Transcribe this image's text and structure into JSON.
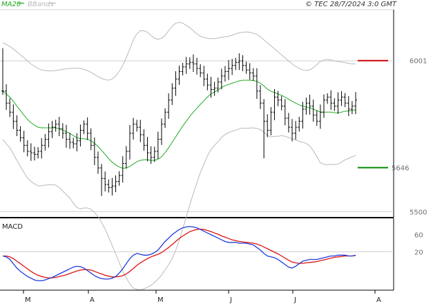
{
  "header": {
    "ma_label": "MA20",
    "bb_label": "BBands",
    "copyright": "© TEC 28/7/2024 3:0 GMT"
  },
  "colors": {
    "ma": "#22aa22",
    "bands": "#b9b9b9",
    "price": "#000000",
    "resistance": "#cc0000",
    "support": "#008800",
    "macd": "#1e3adc",
    "signal": "#dd1111",
    "grid": "#cfcfcf",
    "axis": "#000000"
  },
  "chart_data": [
    {
      "type": "ohlc",
      "name": "price",
      "price_labels": [
        "6001",
        "5646",
        "5500"
      ],
      "ylim": [
        5480,
        6170
      ],
      "grid": [
        6000,
        5500
      ],
      "levels": [
        {
          "label": "6001",
          "value": 6001,
          "color": "#cc0000"
        },
        {
          "label": "5646",
          "value": 5646,
          "color": "#008800"
        }
      ],
      "x_ticks": [
        "M",
        "A",
        "M",
        "J",
        "J",
        "A"
      ],
      "closes": [
        5900,
        5860,
        5830,
        5800,
        5770,
        5745,
        5720,
        5700,
        5695,
        5690,
        5700,
        5720,
        5740,
        5765,
        5780,
        5790,
        5775,
        5760,
        5740,
        5730,
        5725,
        5735,
        5770,
        5790,
        5760,
        5720,
        5680,
        5645,
        5610,
        5590,
        5580,
        5585,
        5600,
        5620,
        5660,
        5700,
        5760,
        5790,
        5780,
        5755,
        5720,
        5695,
        5680,
        5700,
        5740,
        5790,
        5830,
        5870,
        5910,
        5940,
        5965,
        5980,
        5990,
        5995,
        5990,
        5975,
        5960,
        5940,
        5920,
        5905,
        5910,
        5930,
        5950,
        5965,
        5975,
        5985,
        5995,
        6000,
        5985,
        5970,
        5960,
        5950,
        5900,
        5860,
        5800,
        5770,
        5830,
        5880,
        5870,
        5850,
        5810,
        5780,
        5760,
        5780,
        5800,
        5840,
        5860,
        5850,
        5820,
        5800,
        5830,
        5870,
        5880,
        5860,
        5850,
        5870,
        5880,
        5860,
        5840,
        5850,
        5870
      ],
      "ma20": [
        5900,
        5890,
        5880,
        5866,
        5850,
        5835,
        5820,
        5806,
        5795,
        5787,
        5780,
        5778,
        5778,
        5778,
        5778,
        5778,
        5775,
        5770,
        5765,
        5760,
        5752,
        5745,
        5742,
        5742,
        5740,
        5735,
        5726,
        5716,
        5703,
        5690,
        5676,
        5664,
        5655,
        5648,
        5644,
        5645,
        5650,
        5658,
        5666,
        5670,
        5672,
        5672,
        5670,
        5670,
        5674,
        5682,
        5696,
        5712,
        5730,
        5748,
        5766,
        5784,
        5800,
        5816,
        5830,
        5843,
        5856,
        5868,
        5880,
        5890,
        5897,
        5904,
        5912,
        5918,
        5922,
        5926,
        5930,
        5934,
        5936,
        5936,
        5936,
        5935,
        5932,
        5926,
        5917,
        5906,
        5899,
        5895,
        5890,
        5886,
        5880,
        5873,
        5866,
        5860,
        5854,
        5850,
        5847,
        5844,
        5840,
        5835,
        5830,
        5830,
        5830,
        5830,
        5828,
        5828,
        5830,
        5833,
        5834,
        5836,
        5838
      ],
      "bb_upper": [
        6060,
        6055,
        6048,
        6040,
        6030,
        6020,
        6010,
        6000,
        5990,
        5982,
        5975,
        5970,
        5968,
        5967,
        5967,
        5968,
        5970,
        5972,
        5974,
        5975,
        5976,
        5976,
        5975,
        5972,
        5968,
        5962,
        5955,
        5948,
        5942,
        5938,
        5936,
        5940,
        5950,
        5965,
        5985,
        6010,
        6040,
        6070,
        6090,
        6100,
        6100,
        6095,
        6085,
        6075,
        6072,
        6075,
        6085,
        6100,
        6115,
        6125,
        6128,
        6125,
        6118,
        6110,
        6100,
        6090,
        6082,
        6078,
        6075,
        6074,
        6074,
        6076,
        6078,
        6080,
        6082,
        6085,
        6090,
        6093,
        6095,
        6096,
        6095,
        6092,
        6088,
        6080,
        6070,
        6060,
        6050,
        6040,
        6030,
        6020,
        6010,
        6000,
        5990,
        5982,
        5975,
        5970,
        5968,
        5970,
        5978,
        5988,
        5998,
        6003,
        6005,
        6003,
        6000,
        5998,
        5996,
        5994,
        5992,
        5990,
        5990
      ],
      "bb_lower": [
        5740,
        5725,
        5712,
        5692,
        5670,
        5650,
        5630,
        5612,
        5600,
        5592,
        5585,
        5586,
        5588,
        5589,
        5589,
        5588,
        5580,
        5568,
        5556,
        5545,
        5528,
        5514,
        5509,
        5512,
        5512,
        5508,
        5497,
        5484,
        5464,
        5442,
        5416,
        5388,
        5360,
        5331,
        5303,
        5280,
        5260,
        5246,
        5242,
        5240,
        5244,
        5249,
        5255,
        5265,
        5276,
        5289,
        5307,
        5324,
        5345,
        5371,
        5404,
        5443,
        5482,
        5522,
        5560,
        5596,
        5630,
        5658,
        5685,
        5706,
        5720,
        5732,
        5746,
        5756,
        5762,
        5767,
        5770,
        5775,
        5777,
        5776,
        5777,
        5778,
        5776,
        5772,
        5764,
        5752,
        5748,
        5750,
        5750,
        5752,
        5750,
        5746,
        5742,
        5738,
        5733,
        5730,
        5726,
        5718,
        5702,
        5682,
        5662,
        5657,
        5655,
        5657,
        5656,
        5658,
        5664,
        5672,
        5676,
        5682,
        5686
      ]
    },
    {
      "type": "line",
      "name": "MACD",
      "title": "MACD",
      "y_labels": [
        "60",
        "20"
      ],
      "ylim": [
        -70,
        95
      ],
      "grid": [
        20
      ],
      "series": [
        {
          "color": "#1e3adc",
          "values": [
            10,
            8,
            2,
            -8,
            -18,
            -26,
            -32,
            -38,
            -42,
            -46,
            -48,
            -48,
            -46,
            -43,
            -40,
            -36,
            -32,
            -28,
            -24,
            -20,
            -16,
            -14,
            -15,
            -18,
            -24,
            -30,
            -36,
            -40,
            -43,
            -44,
            -44,
            -42,
            -38,
            -30,
            -20,
            -8,
            4,
            12,
            16,
            14,
            12,
            12,
            14,
            18,
            24,
            34,
            44,
            52,
            60,
            66,
            72,
            76,
            78,
            79,
            78,
            76,
            72,
            68,
            64,
            60,
            56,
            52,
            48,
            44,
            42,
            42,
            42,
            40,
            40,
            40,
            38,
            36,
            30,
            24,
            16,
            10,
            8,
            6,
            2,
            -4,
            -10,
            -16,
            -18,
            -14,
            -8,
            -2,
            0,
            2,
            2,
            2,
            4,
            6,
            8,
            10,
            10,
            12,
            12,
            12,
            10,
            10,
            12
          ]
        },
        {
          "color": "#dd1111",
          "values": [
            10,
            10,
            8,
            4,
            -2,
            -8,
            -14,
            -20,
            -26,
            -31,
            -35,
            -38,
            -40,
            -41,
            -41,
            -40,
            -38,
            -36,
            -34,
            -31,
            -28,
            -25,
            -23,
            -22,
            -22,
            -23,
            -26,
            -29,
            -32,
            -35,
            -37,
            -39,
            -39,
            -38,
            -36,
            -32,
            -26,
            -19,
            -12,
            -6,
            -1,
            4,
            8,
            11,
            14,
            18,
            24,
            30,
            37,
            44,
            51,
            57,
            62,
            67,
            70,
            72,
            73,
            72,
            70,
            67,
            64,
            61,
            57,
            54,
            51,
            48,
            46,
            44,
            43,
            42,
            41,
            40,
            38,
            35,
            31,
            27,
            23,
            19,
            15,
            10,
            5,
            0,
            -4,
            -6,
            -7,
            -7,
            -6,
            -5,
            -4,
            -3,
            -1,
            1,
            3,
            5,
            7,
            8,
            9,
            10,
            10,
            10,
            11
          ]
        }
      ]
    }
  ]
}
